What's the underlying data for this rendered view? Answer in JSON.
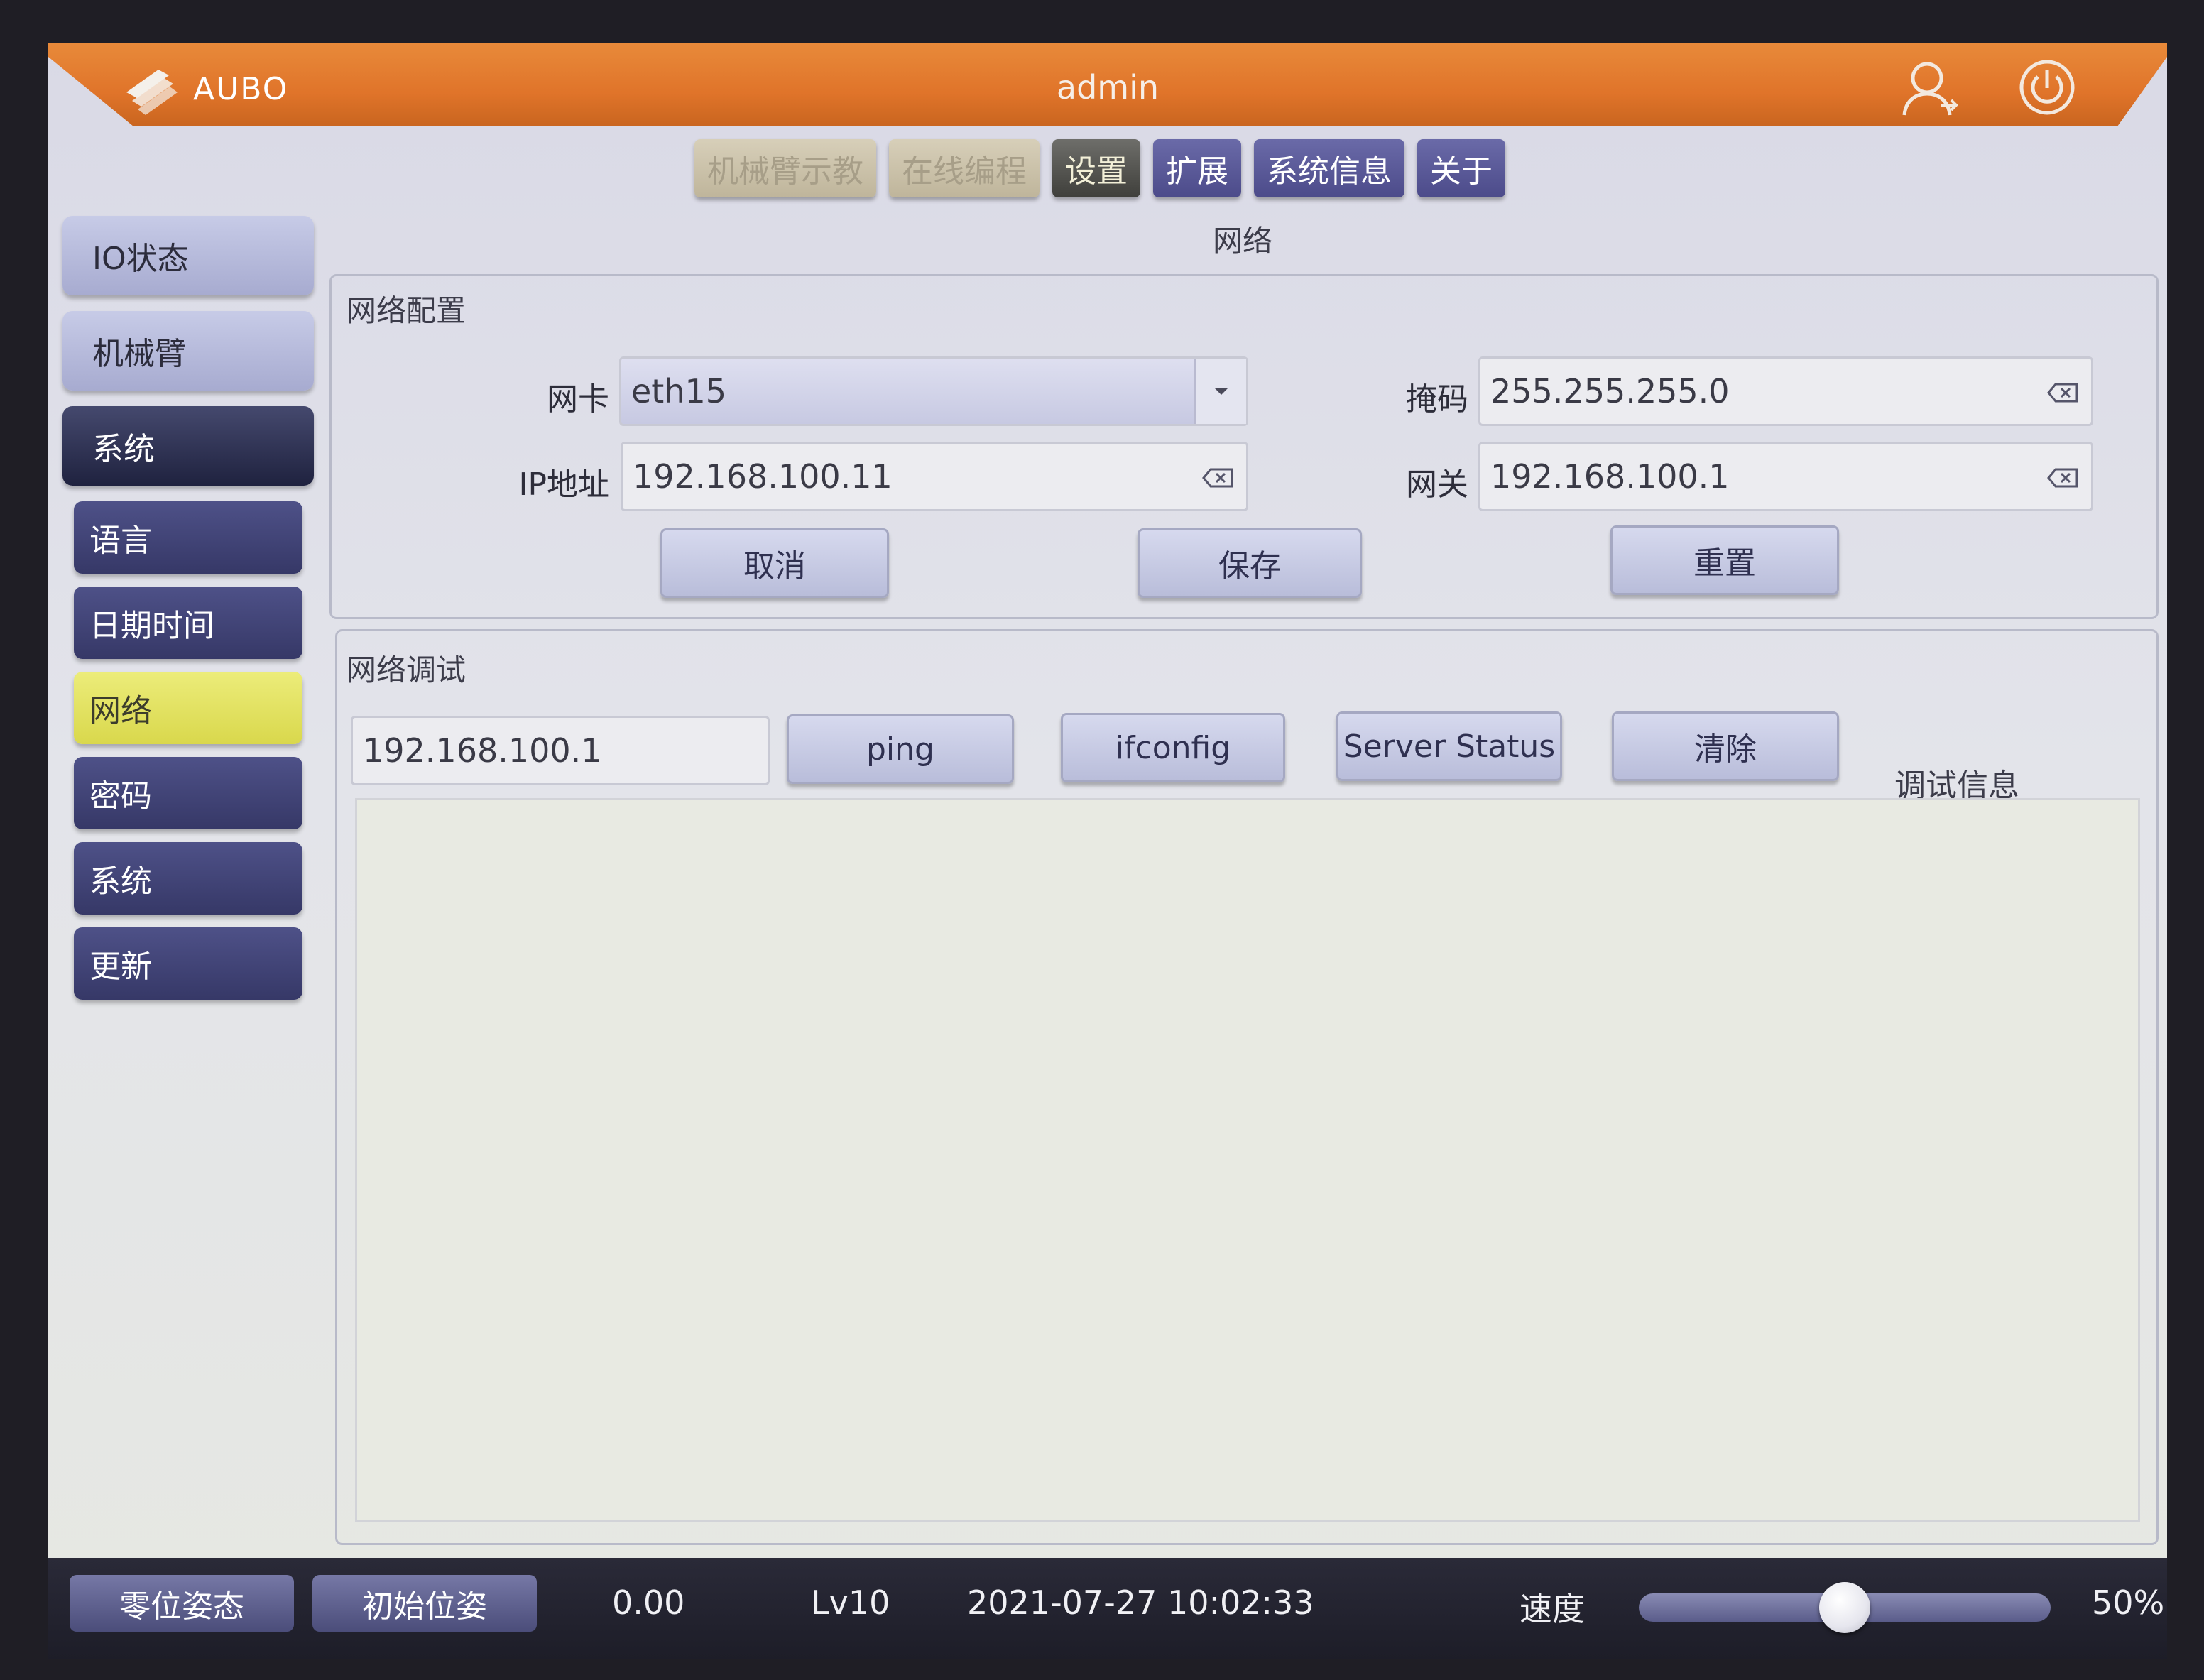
{
  "header": {
    "logo_text": "AUBO",
    "user": "admin"
  },
  "tabs": [
    {
      "label": "机械臂示教",
      "state": "disabled"
    },
    {
      "label": "在线编程",
      "state": "disabled"
    },
    {
      "label": "设置",
      "state": "active"
    },
    {
      "label": "扩展",
      "state": "normal"
    },
    {
      "label": "系统信息",
      "state": "normal"
    },
    {
      "label": "关于",
      "state": "normal"
    }
  ],
  "page_title": "网络",
  "sidebar": {
    "top_items": [
      {
        "label": "IO状态"
      },
      {
        "label": "机械臂"
      },
      {
        "label": "系统",
        "active": true
      }
    ],
    "sub_items": [
      {
        "label": "语言"
      },
      {
        "label": "日期时间"
      },
      {
        "label": "网络",
        "active": true
      },
      {
        "label": "密码"
      },
      {
        "label": "系统"
      },
      {
        "label": "更新"
      }
    ]
  },
  "network_config": {
    "group_label": "网络配置",
    "nic_label": "网卡",
    "nic_value": "eth15",
    "ip_label": "IP地址",
    "ip_value": "192.168.100.11",
    "mask_label": "掩码",
    "mask_value": "255.255.255.0",
    "gateway_label": "网关",
    "gateway_value": "192.168.100.1",
    "cancel_label": "取消",
    "save_label": "保存",
    "reset_label": "重置"
  },
  "network_debug": {
    "group_label": "网络调试",
    "target_value": "192.168.100.1",
    "ping_label": "ping",
    "ifconfig_label": "ifconfig",
    "server_status_label": "Server Status",
    "clear_label": "清除",
    "debug_info_label": "调试信息",
    "output_text": ""
  },
  "status_bar": {
    "zero_pose_label": "零位姿态",
    "init_pose_label": "初始位姿",
    "value": "0.00",
    "level": "Lv10",
    "datetime": "2021-07-27 10:02:33",
    "speed_label": "速度",
    "speed_percent": 50,
    "speed_text": "50%"
  },
  "colors": {
    "header_orange": "#e0742a",
    "tab_blue": "#4c4b8a",
    "sidebar_active_yellow": "#d9d84c"
  },
  "icons": [
    "aubo-logo-icon",
    "user-icon",
    "power-icon",
    "dropdown-arrow-icon",
    "clear-input-icon"
  ]
}
